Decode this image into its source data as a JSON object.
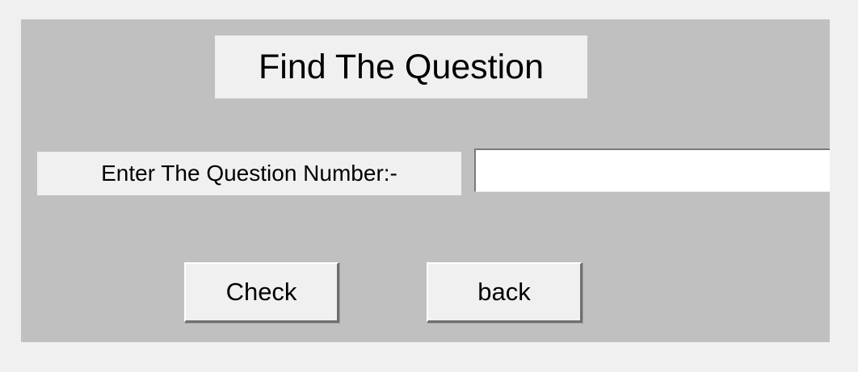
{
  "window": {
    "title": "Find The Question"
  },
  "form": {
    "label": "Enter The Question Number:-",
    "question_number_value": "",
    "question_number_placeholder": ""
  },
  "buttons": {
    "check_label": "Check",
    "back_label": "back"
  },
  "colors": {
    "window_background": "#f0f0f0",
    "panel_background": "#c0c0c0",
    "input_background": "#ffffff",
    "button_face": "#f0f0f0"
  }
}
